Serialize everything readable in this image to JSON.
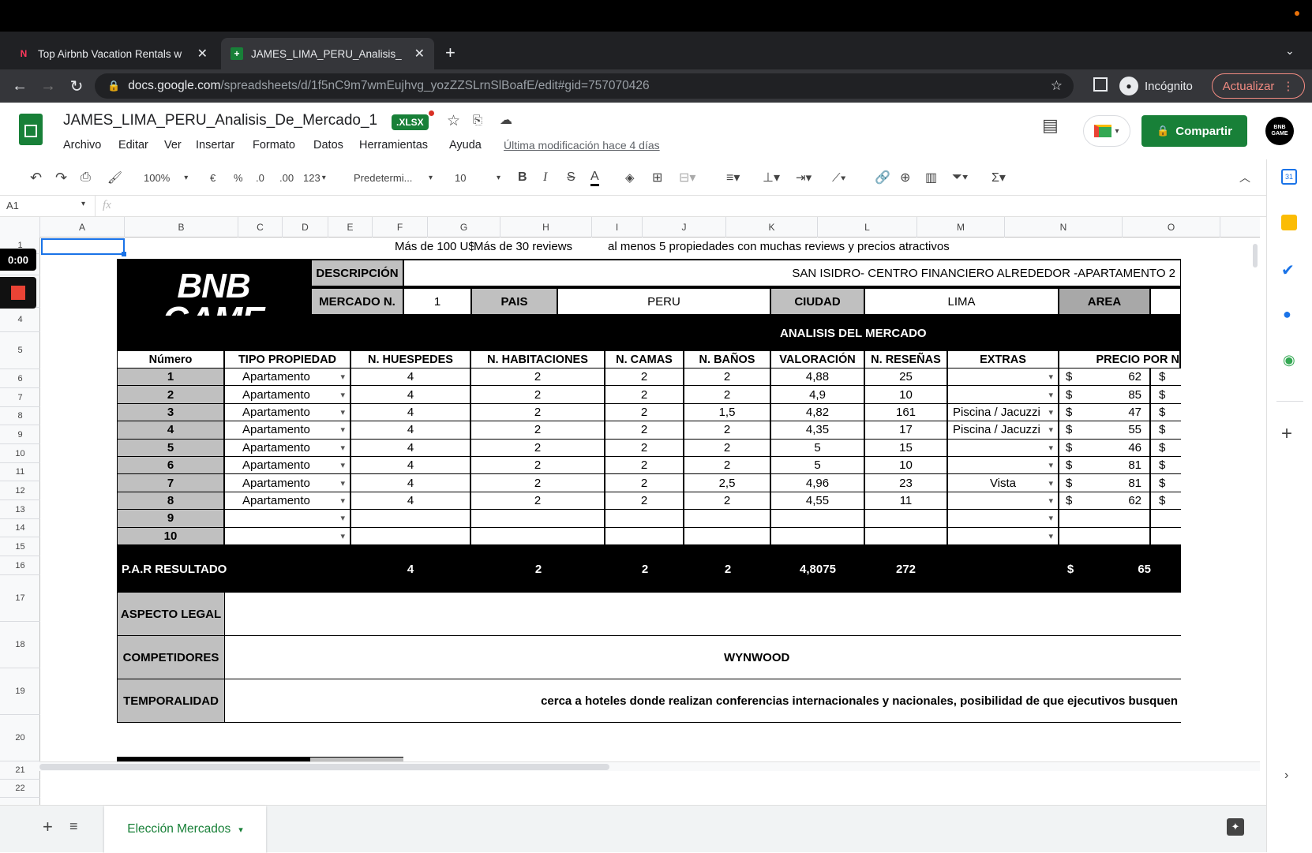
{
  "browser": {
    "tabs": [
      {
        "title": "Top Airbnb Vacation Rentals w",
        "icon": "airbnb-icon"
      },
      {
        "title": "JAMES_LIMA_PERU_Analisis_",
        "icon": "sheets-icon"
      }
    ],
    "url_host": "docs.google.com",
    "url_path": "/spreadsheets/d/1f5nC9m7wmEujhvg_yozZZSLrnSlBoafE/edit#gid=757070426",
    "incognito_label": "Incógnito",
    "update_label": "Actualizar"
  },
  "sheets": {
    "title": "JAMES_LIMA_PERU_Analisis_De_Mercado_1",
    "format_badge": ".XLSX",
    "menus": [
      "Archivo",
      "Editar",
      "Ver",
      "Insertar",
      "Formato",
      "Datos",
      "Herramientas",
      "Ayuda"
    ],
    "last_modified": "Última modificación hace 4 días",
    "share_label": "Compartir",
    "avatar_text": "BNB GAME"
  },
  "toolbar": {
    "zoom": "100%",
    "currency": "€",
    "percent": "%",
    "dec_less": ".0",
    "dec_more": ".00",
    "format_num": "123",
    "font": "Predetermi...",
    "font_size": "10"
  },
  "formula": {
    "cell_ref": "A1",
    "fx": "fx"
  },
  "recording": {
    "time": "0:00"
  },
  "columns": [
    "A",
    "B",
    "C",
    "D",
    "E",
    "F",
    "G",
    "H",
    "I",
    "J",
    "K",
    "L",
    "M",
    "N",
    "O"
  ],
  "rows": [
    "1",
    "2",
    "3",
    "4",
    "5",
    "6",
    "7",
    "8",
    "9",
    "10",
    "11",
    "12",
    "13",
    "14",
    "15",
    "16",
    "17",
    "18",
    "19",
    "20",
    "21",
    "22"
  ],
  "sheet": {
    "row1_note1": "Más de 100 U$",
    "row1_note2": "Más de 30 reviews",
    "row1_note3": "al menos 5 propiedades con muchas reviews y precios atractivos",
    "logo_line1": "BNB",
    "logo_line2": "GAME",
    "desc_label": "DESCRIPCIÓN",
    "desc_value": "SAN ISIDRO- CENTRO FINANCIERO ALREDEDOR -APARTAMENTO 2",
    "mercado_label": "MERCADO N.",
    "mercado_value": "1",
    "pais_label": "PAIS",
    "pais_value": "PERU",
    "ciudad_label": "CIUDAD",
    "ciudad_value": "LIMA",
    "area_label": "AREA",
    "analisis_title": "ANALISIS DEL MERCADO",
    "headers": [
      "Número",
      "TIPO PROPIEDAD",
      "N. HUESPEDES",
      "N. HABITACIONES",
      "N. CAMAS",
      "N. BAÑOS",
      "VALORACIÓN",
      "N. RESEÑAS",
      "EXTRAS",
      "PRECIO POR N"
    ],
    "data": [
      {
        "n": "1",
        "tipo": "Apartamento",
        "hue": "4",
        "hab": "2",
        "cam": "2",
        "ban": "2",
        "val": "4,88",
        "res": "25",
        "ext": "",
        "cur": "$",
        "pre": "62",
        "cur2": "$"
      },
      {
        "n": "2",
        "tipo": "Apartamento",
        "hue": "4",
        "hab": "2",
        "cam": "2",
        "ban": "2",
        "val": "4,9",
        "res": "10",
        "ext": "",
        "cur": "$",
        "pre": "85",
        "cur2": "$"
      },
      {
        "n": "3",
        "tipo": "Apartamento",
        "hue": "4",
        "hab": "2",
        "cam": "2",
        "ban": "1,5",
        "val": "4,82",
        "res": "161",
        "ext": "Piscina / Jacuzzi",
        "cur": "$",
        "pre": "47",
        "cur2": "$"
      },
      {
        "n": "4",
        "tipo": "Apartamento",
        "hue": "4",
        "hab": "2",
        "cam": "2",
        "ban": "2",
        "val": "4,35",
        "res": "17",
        "ext": "Piscina / Jacuzzi",
        "cur": "$",
        "pre": "55",
        "cur2": "$"
      },
      {
        "n": "5",
        "tipo": "Apartamento",
        "hue": "4",
        "hab": "2",
        "cam": "2",
        "ban": "2",
        "val": "5",
        "res": "15",
        "ext": "",
        "cur": "$",
        "pre": "46",
        "cur2": "$"
      },
      {
        "n": "6",
        "tipo": "Apartamento",
        "hue": "4",
        "hab": "2",
        "cam": "2",
        "ban": "2",
        "val": "5",
        "res": "10",
        "ext": "",
        "cur": "$",
        "pre": "81",
        "cur2": "$"
      },
      {
        "n": "7",
        "tipo": "Apartamento",
        "hue": "4",
        "hab": "2",
        "cam": "2",
        "ban": "2,5",
        "val": "4,96",
        "res": "23",
        "ext": "Vista",
        "cur": "$",
        "pre": "81",
        "cur2": "$"
      },
      {
        "n": "8",
        "tipo": "Apartamento",
        "hue": "4",
        "hab": "2",
        "cam": "2",
        "ban": "2",
        "val": "4,55",
        "res": "11",
        "ext": "",
        "cur": "$",
        "pre": "62",
        "cur2": "$"
      },
      {
        "n": "9",
        "tipo": "",
        "hue": "",
        "hab": "",
        "cam": "",
        "ban": "",
        "val": "",
        "res": "",
        "ext": "",
        "cur": "",
        "pre": "",
        "cur2": ""
      },
      {
        "n": "10",
        "tipo": "",
        "hue": "",
        "hab": "",
        "cam": "",
        "ban": "",
        "val": "",
        "res": "",
        "ext": "",
        "cur": "",
        "pre": "",
        "cur2": ""
      }
    ],
    "result": {
      "label": "P.A.R RESULTADO",
      "hue": "4",
      "hab": "2",
      "cam": "2",
      "ban": "2",
      "val": "4,8075",
      "res": "272",
      "cur": "$",
      "pre": "65"
    },
    "legal_label": "ASPECTO LEGAL",
    "comp_label": "COMPETIDORES",
    "comp_value": "WYNWOOD",
    "temp_label": "TEMPORALIDAD",
    "temp_value": "cerca a hoteles donde realizan conferencias internacionales y nacionales, posibilidad de que ejecutivos busquen"
  },
  "bottom": {
    "sheet_tab": "Elección Mercados"
  },
  "colors": {
    "sheets_green": "#188038",
    "chrome_dark": "#202124",
    "gray_cell": "#c0c0c0"
  }
}
